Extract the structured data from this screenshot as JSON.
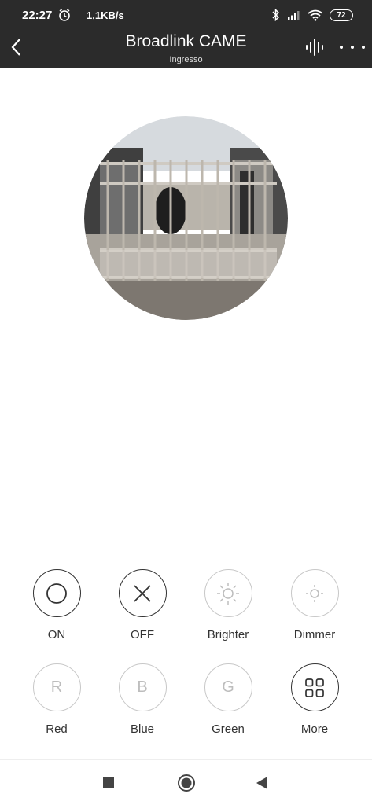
{
  "status_bar": {
    "time": "22:27",
    "net_speed": "1,1KB/s",
    "battery": "72"
  },
  "header": {
    "title": "Broadlink CAME",
    "subtitle": "Ingresso"
  },
  "controls": [
    {
      "label": "ON"
    },
    {
      "label": "OFF"
    },
    {
      "label": "Brighter"
    },
    {
      "label": "Dimmer"
    },
    {
      "label": "Red",
      "letter": "R"
    },
    {
      "label": "Blue",
      "letter": "B"
    },
    {
      "label": "Green",
      "letter": "G"
    },
    {
      "label": "More"
    }
  ],
  "colors": {
    "header_bg": "#2b2b2b",
    "active_ring": "#333333",
    "inactive_ring": "#c8c8c8"
  }
}
